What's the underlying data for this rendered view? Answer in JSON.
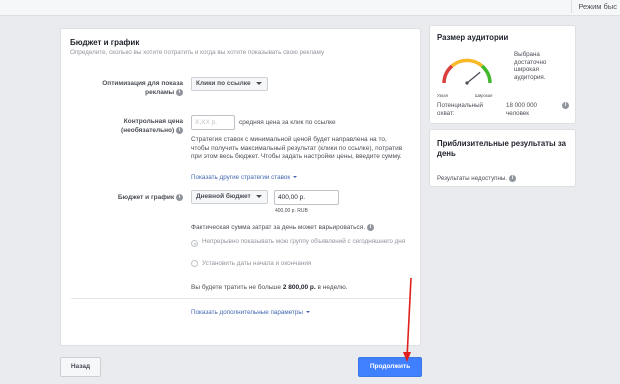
{
  "topbar": {
    "mode_button": "Режим быс"
  },
  "budget_panel": {
    "title": "Бюджет и график",
    "subtitle": "Определите, сколько вы хотите потратить и когда вы хотите показывать свою рекламу",
    "optimization": {
      "label": "Оптимизация для показа рекламы",
      "value": "Клики по ссылке"
    },
    "control_price": {
      "label": "Контрольная цена (необязательно)",
      "placeholder": "X,XX р.",
      "inline_text": "средняя цена за клик по ссылке",
      "description": "Стратегия ставок с минимальной ценой будет направлена на то, чтобы получить максимальный результат (клики по ссылке), потратив при этом весь бюджет. Чтобы задать настройки цены, введите сумму.",
      "link": "Показать другие стратегии ставок"
    },
    "budget": {
      "label": "Бюджет и график",
      "type_value": "Дневной бюджет",
      "amount_value": "400,00 р.",
      "amount_note": "400,00 р. RUB",
      "variation_text": "Фактическая сумма затрат за день может варьироваться.",
      "radio_options": [
        {
          "label": "Непрерывно показывать мою группу объявлений с сегодняшнего дня",
          "checked": true
        },
        {
          "label": "Установить даты начала и окончания",
          "checked": false
        }
      ],
      "spend_prefix": "Вы будете тратить не больше ",
      "spend_amount": "2 800,00 р.",
      "spend_suffix": " в неделю."
    },
    "more_params_link": "Показать дополнительные параметры"
  },
  "buttons": {
    "back": "Назад",
    "continue": "Продолжить"
  },
  "audience_card": {
    "title": "Размер аудитории",
    "gauge_left": "Узкая",
    "gauge_right": "Широкая",
    "gauge_level": 0.78,
    "status_lines": [
      "Выбрана",
      "достаточно",
      "широкая",
      "аудитория."
    ],
    "potential_label_lines": [
      "Потенциальный",
      "охват:"
    ],
    "potential_value_lines": [
      "18 000 000",
      "человек"
    ]
  },
  "results_card": {
    "title_lines": [
      "Приблизительные результаты за",
      "день"
    ],
    "unavailable": "Результаты недоступны."
  },
  "colors": {
    "accent": "#4080ff",
    "link": "#4267b2",
    "gauge_red": "#d93f3f",
    "gauge_yellow": "#f7b928",
    "gauge_green": "#42b72a",
    "annotation_arrow": "#e0201b"
  }
}
